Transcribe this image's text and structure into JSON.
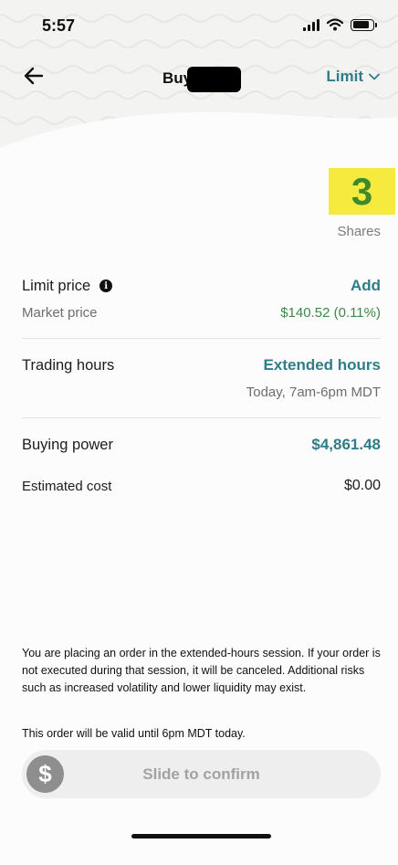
{
  "status_bar": {
    "time": "5:57"
  },
  "nav": {
    "title": "Buy",
    "order_type": "Limit"
  },
  "quantity": {
    "value": "3",
    "unit": "Shares"
  },
  "limit_price": {
    "label": "Limit price",
    "action": "Add"
  },
  "market_price": {
    "label": "Market price",
    "value": "$140.52 (0.11%)"
  },
  "trading_hours": {
    "label": "Trading hours",
    "value": "Extended hours",
    "detail": "Today, 7am-6pm MDT"
  },
  "buying_power": {
    "label": "Buying power",
    "value": "$4,861.48"
  },
  "estimated_cost": {
    "label": "Estimated cost",
    "value": "$0.00"
  },
  "disclaimer": {
    "paragraph1": "You are placing an order in the extended-hours session. If your order is not executed during that session, it will be canceled. Additional risks such as increased volatility and lower liquidity may exist.",
    "paragraph2": "This order will be valid until 6pm MDT today."
  },
  "slider": {
    "label": "Slide to confirm",
    "knob_symbol": "$"
  },
  "colors": {
    "accent": "#2e7d8b",
    "positive": "#3c8a46",
    "highlight": "#f6ea3e"
  }
}
